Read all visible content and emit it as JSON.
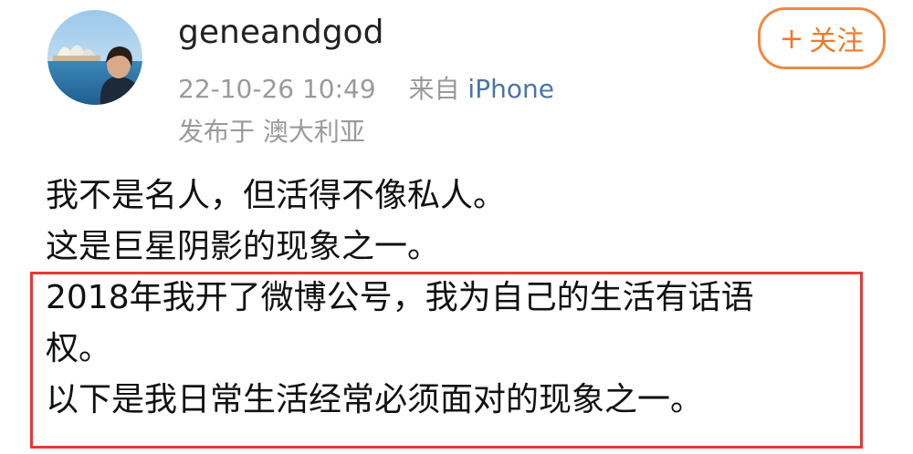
{
  "user": {
    "username": "geneandgod",
    "timestamp": "22-10-26 10:49",
    "source_prefix": "来自",
    "source_device": "iPhone",
    "location": "发布于 澳大利亚"
  },
  "follow_button": {
    "plus": "+",
    "label": "关注",
    "color": "#ee7a2a"
  },
  "post": {
    "lines": [
      "我不是名人，但活得不像私人。",
      "这是巨星阴影的现象之一。",
      "2018年我开了微博公号，我为自己的生活有话语",
      "权。",
      "以下是我日常生活经常必须面对的现象之一。"
    ]
  },
  "highlight": {
    "color": "#e53935"
  }
}
